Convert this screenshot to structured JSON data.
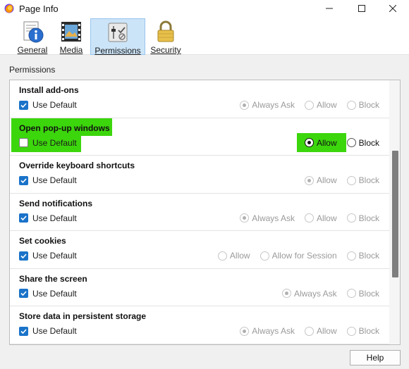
{
  "window": {
    "title": "Page Info",
    "controls": {
      "minimize": "minimize",
      "maximize": "maximize",
      "close": "close"
    }
  },
  "tabs": [
    {
      "label": "General",
      "icon": "info-icon",
      "active": false
    },
    {
      "label": "Media",
      "icon": "film-icon",
      "active": false
    },
    {
      "label": "Permissions",
      "icon": "sliders-icon",
      "active": true
    },
    {
      "label": "Security",
      "icon": "padlock-icon",
      "active": false
    }
  ],
  "section_label": "Permissions",
  "permissions": [
    {
      "title": "Install add-ons",
      "use_default": true,
      "options": [
        {
          "label": "Always Ask",
          "selected": true
        },
        {
          "label": "Allow",
          "selected": false
        },
        {
          "label": "Block",
          "selected": false
        }
      ]
    },
    {
      "title": "Open pop-up windows",
      "use_default": false,
      "highlighted": true,
      "options": [
        {
          "label": "Allow",
          "selected": true
        },
        {
          "label": "Block",
          "selected": false
        }
      ]
    },
    {
      "title": "Override keyboard shortcuts",
      "use_default": true,
      "options": [
        {
          "label": "Allow",
          "selected": true
        },
        {
          "label": "Block",
          "selected": false
        }
      ]
    },
    {
      "title": "Send notifications",
      "use_default": true,
      "options": [
        {
          "label": "Always Ask",
          "selected": true
        },
        {
          "label": "Allow",
          "selected": false
        },
        {
          "label": "Block",
          "selected": false
        }
      ]
    },
    {
      "title": "Set cookies",
      "use_default": true,
      "options": [
        {
          "label": "Allow",
          "selected": false
        },
        {
          "label": "Allow for Session",
          "selected": false
        },
        {
          "label": "Block",
          "selected": false
        }
      ]
    },
    {
      "title": "Share the screen",
      "use_default": true,
      "options": [
        {
          "label": "Always Ask",
          "selected": true
        },
        {
          "label": "Block",
          "selected": false
        }
      ]
    },
    {
      "title": "Store data in persistent storage",
      "use_default": true,
      "options": [
        {
          "label": "Always Ask",
          "selected": true
        },
        {
          "label": "Allow",
          "selected": false
        },
        {
          "label": "Block",
          "selected": false
        }
      ]
    }
  ],
  "use_default_label": "Use Default",
  "help_button": "Help",
  "colors": {
    "highlight": "#3cd60d",
    "accent": "#1a73c9",
    "active_tab": "#cce4f7"
  }
}
